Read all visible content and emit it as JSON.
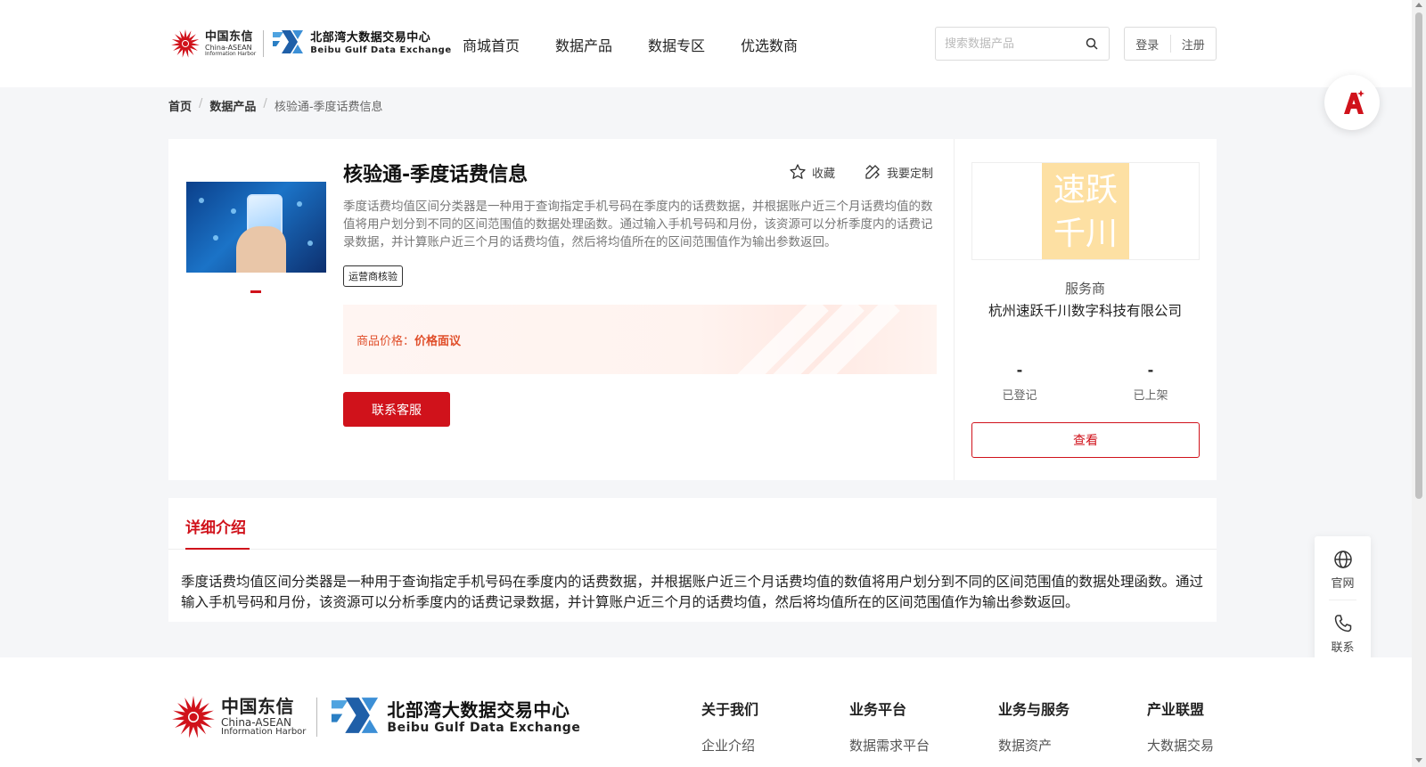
{
  "header": {
    "brand1_cn": "中国东信",
    "brand1_en": "China-ASEAN",
    "brand1_en2": "Information Harbor",
    "brand2_cn": "北部湾大数据交易中心",
    "brand2_en": "Beibu Gulf Data Exchange",
    "nav": [
      "商城首页",
      "数据产品",
      "数据专区",
      "优选数商"
    ],
    "search_placeholder": "搜索数据产品",
    "login": "登录",
    "register": "注册"
  },
  "breadcrumb": [
    "首页",
    "数据产品",
    "核验通-季度话费信息"
  ],
  "product": {
    "title": "核验通-季度话费信息",
    "collect": "收藏",
    "customize": "我要定制",
    "description": "季度话费均值区间分类器是一种用于查询指定手机号码在季度内的话费数据，并根据账户近三个月话费均值的数值将用户划分到不同的区间范围值的数据处理函数。通过输入手机号码和月份，该资源可以分析季度内的话费记录数据，并计算账户近三个月的话费均值，然后将均值所在的区间范围值作为输出参数返回。",
    "tag": "运营商核验",
    "price_label": "商品价格：",
    "price_value": "价格面议",
    "contact_button": "联系客服"
  },
  "provider": {
    "logo_line1": "速跃",
    "logo_line2": "千川",
    "type_label": "服务商",
    "name": "杭州速跃千川数字科技有限公司",
    "registered_value": "-",
    "registered_label": "已登记",
    "listed_value": "-",
    "listed_label": "已上架",
    "view_button": "查看"
  },
  "detail": {
    "tab": "详细介绍",
    "text": "季度话费均值区间分类器是一种用于查询指定手机号码在季度内的话费数据，并根据账户近三个月话费均值的数值将用户划分到不同的区间范围值的数据处理函数。通过输入手机号码和月份，该资源可以分析季度内的话费记录数据，并计算账户近三个月的话费均值，然后将均值所在的区间范围值作为输出参数返回。"
  },
  "side_float": {
    "official": "官网",
    "contact": "联系"
  },
  "footer": {
    "columns": [
      {
        "heading": "关于我们",
        "item": "企业介绍"
      },
      {
        "heading": "业务平台",
        "item": "数据需求平台"
      },
      {
        "heading": "业务与服务",
        "item": "数据资产"
      },
      {
        "heading": "产业联盟",
        "item": "大数据交易"
      }
    ]
  },
  "colors": {
    "accent": "#d0121b",
    "price": "#e04e2a",
    "provider_logo_bg": "#fde0a3"
  },
  "icons": [
    "search-icon",
    "star-icon",
    "customize-icon",
    "ai-assistant-icon",
    "globe-icon",
    "phone-icon"
  ]
}
